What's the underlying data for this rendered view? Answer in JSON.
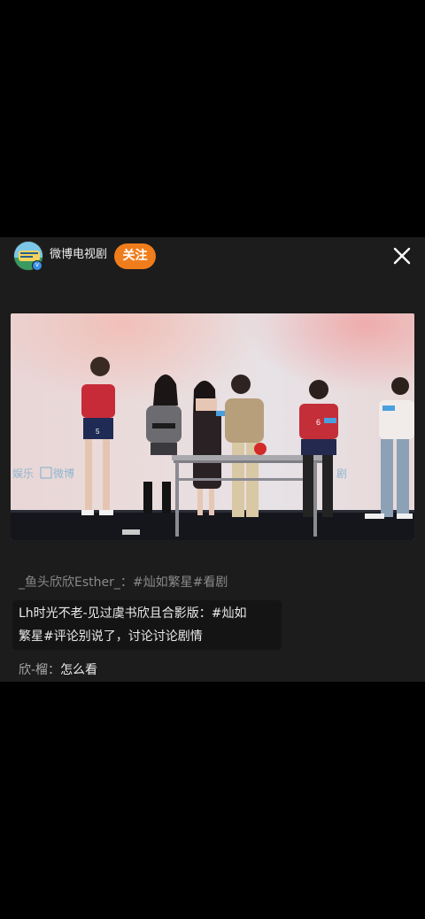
{
  "header": {
    "account_name": "微博电视剧",
    "follow_label": "关注",
    "verified_mark": "v"
  },
  "photo": {
    "watermark_left": "娱乐",
    "watermark_weibo": "微博",
    "watermark_right": "剧",
    "jersey_numbers": [
      "5",
      "6"
    ]
  },
  "comments": [
    {
      "text": "_鱼头欣欣Esther_：#灿如繁星#看剧"
    },
    {
      "line1": "Lh时光不老-见过虞书欣且合影版：#灿如",
      "line2": "繁星#评论别说了，讨论讨论剧情"
    },
    {
      "author": "欣-榴：",
      "text": "怎么看"
    }
  ],
  "colors": {
    "background": "#000000",
    "panel": "#1c1c1c",
    "follow_button": "#f07d1c",
    "muted_text": "#8a8a8a"
  },
  "icons": [
    "close-icon",
    "verified-icon"
  ]
}
